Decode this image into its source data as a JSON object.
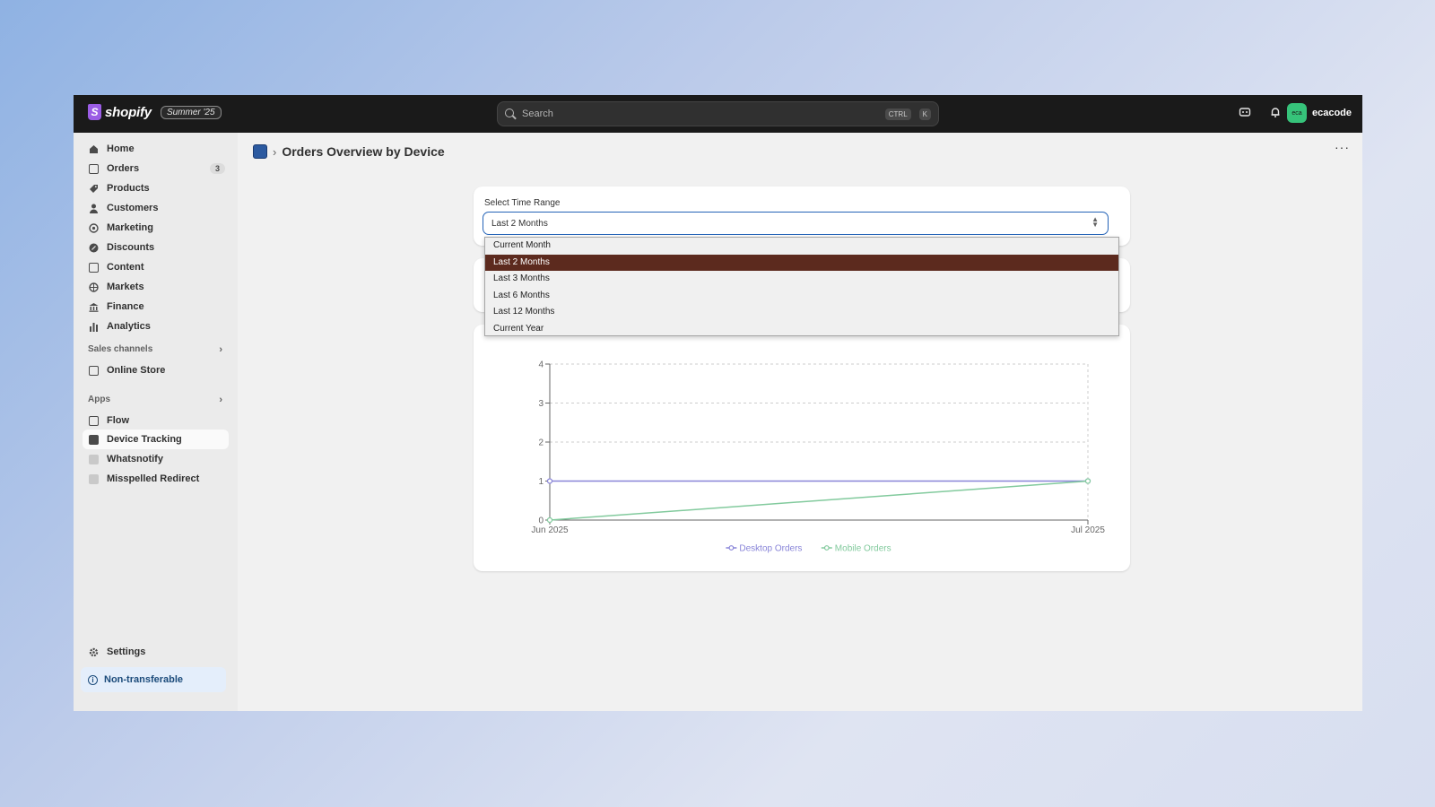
{
  "topbar": {
    "brand": "shopify",
    "brand_mark": "S",
    "edition": "Summer '25",
    "search_placeholder": "Search",
    "shortcut_keys": [
      "CTRL",
      "K"
    ],
    "user_initials": "eca",
    "user_name": "ecacode"
  },
  "sidebar": {
    "items": [
      {
        "label": "Home",
        "icon": "home-icon"
      },
      {
        "label": "Orders",
        "icon": "orders-icon",
        "badge": "3"
      },
      {
        "label": "Products",
        "icon": "tag-icon"
      },
      {
        "label": "Customers",
        "icon": "person-icon"
      },
      {
        "label": "Marketing",
        "icon": "target-icon"
      },
      {
        "label": "Discounts",
        "icon": "discount-icon"
      },
      {
        "label": "Content",
        "icon": "image-icon"
      },
      {
        "label": "Markets",
        "icon": "globe-icon"
      },
      {
        "label": "Finance",
        "icon": "bank-icon"
      },
      {
        "label": "Analytics",
        "icon": "bar-chart-icon"
      }
    ],
    "sales_channels_label": "Sales channels",
    "sales_channels": [
      {
        "label": "Online Store",
        "icon": "store-icon"
      }
    ],
    "apps_label": "Apps",
    "apps": [
      {
        "label": "Flow",
        "icon": "flow-icon"
      },
      {
        "label": "Device Tracking",
        "icon": "device-tracking-icon"
      },
      {
        "label": "Whatsnotify",
        "icon": "whatsnotify-icon"
      },
      {
        "label": "Misspelled Redirect",
        "icon": "redirect-icon"
      }
    ],
    "settings_label": "Settings",
    "notice_label": "Non-transferable"
  },
  "page": {
    "title": "Orders Overview by Device",
    "breadcrumb_separator": "›"
  },
  "time_range": {
    "label": "Select Time Range",
    "selected": "Last 2 Months",
    "options": [
      "Current Month",
      "Last 2 Months",
      "Last 3 Months",
      "Last 6 Months",
      "Last 12 Months",
      "Current Year"
    ]
  },
  "chart_data": {
    "type": "line",
    "x": [
      "Jun 2025",
      "Jul 2025"
    ],
    "series": [
      {
        "name": "Desktop Orders",
        "values": [
          1,
          1
        ],
        "color": "#8884d8"
      },
      {
        "name": "Mobile Orders",
        "values": [
          0,
          1
        ],
        "color": "#82ca9d"
      }
    ],
    "ylim": [
      0,
      4
    ],
    "yticks": [
      0,
      1,
      2,
      3,
      4
    ],
    "grid": true,
    "legend": "bottom-center"
  },
  "colors": {
    "accent": "#2463b7",
    "dropdown_selected": "#5c2a1e",
    "topbar": "#1a1a1a"
  }
}
